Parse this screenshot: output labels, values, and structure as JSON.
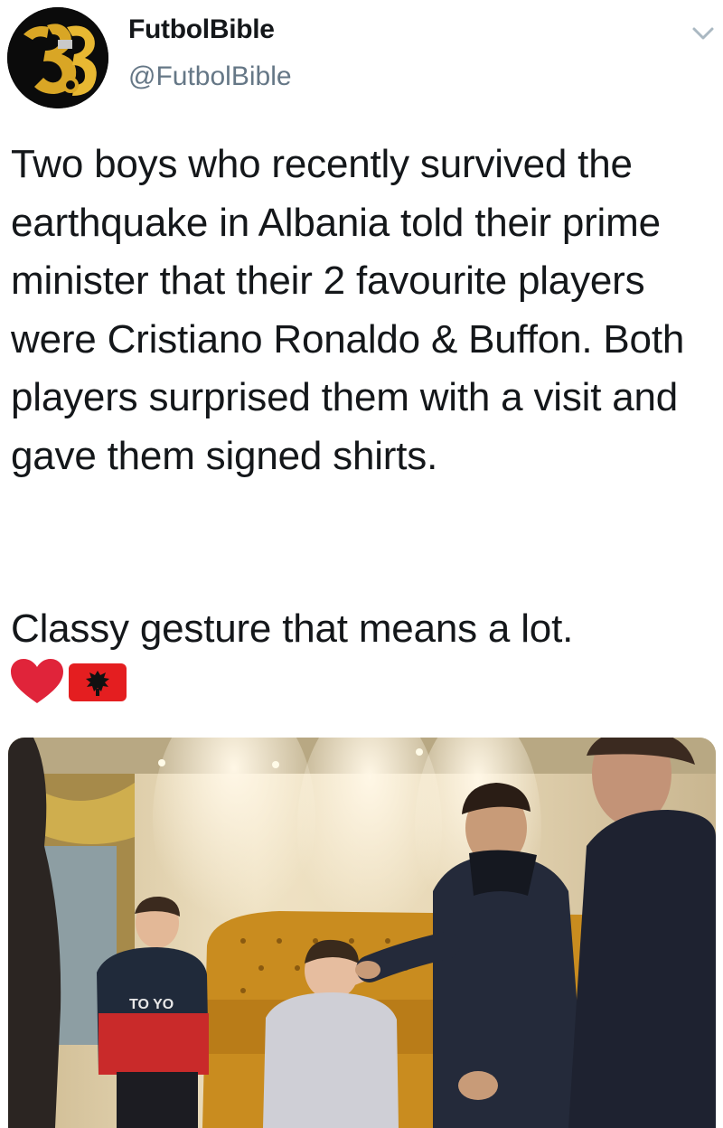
{
  "author": {
    "display_name": "FutbolBible",
    "handle": "@FutbolBible",
    "avatar_icon": "futbolbible-logo"
  },
  "menu": {
    "icon": "chevron-down-icon"
  },
  "tweet": {
    "paragraphs": [
      "Two boys who recently survived the earthquake in Albania told their prime minister that their 2 favourite players were Cristiano Ronaldo & Buffon. Both players surprised them with a visit and gave them signed shirts.",
      "Classy gesture that means a lot."
    ],
    "emojis": [
      "red-heart-emoji",
      "albania-flag-emoji"
    ]
  },
  "media": {
    "type": "video-still",
    "shirt_text": "TO  YO"
  },
  "colors": {
    "text": "#14171a",
    "secondary": "#657786",
    "heart": "#e0243a",
    "flag": "#e41e20"
  }
}
